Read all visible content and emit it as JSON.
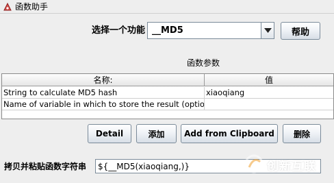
{
  "window": {
    "title": "函数助手"
  },
  "selector": {
    "label": "选择一个功能",
    "value": "__MD5",
    "help_label": "帮助"
  },
  "params": {
    "title": "函数参数",
    "columns": [
      "名称:",
      "值"
    ],
    "rows": [
      {
        "name": "String to calculate MD5 hash",
        "value": "xiaoqiang"
      },
      {
        "name": "Name of variable in which to store the result (optional)",
        "value": ""
      }
    ]
  },
  "actions": {
    "detail": "Detail",
    "add": "添加",
    "clipboard": "Add from Clipboard",
    "delete": "删除"
  },
  "copy": {
    "label": "拷贝并粘贴函数字符串",
    "value": "${__MD5(xiaoqiang,)}"
  },
  "watermark": {
    "text": "创新互联"
  },
  "colors": {
    "background": "#eeeeee",
    "button_border": "#7a8a99"
  }
}
